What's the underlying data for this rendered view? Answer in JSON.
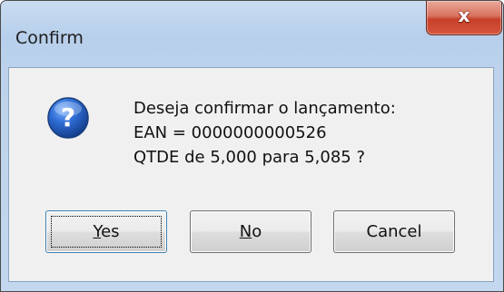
{
  "window": {
    "title": "Confirm",
    "close_glyph": "x"
  },
  "message": {
    "icon": "question-icon",
    "lines": [
      "Deseja confirmar o lançamento:",
      "EAN = 0000000000526",
      "QTDE de 5,000 para 5,085 ?"
    ]
  },
  "buttons": {
    "yes": {
      "mnemonic": "Y",
      "rest": "es"
    },
    "no": {
      "mnemonic": "N",
      "rest": "o"
    },
    "cancel": {
      "label": "Cancel"
    }
  },
  "colors": {
    "icon_blue": "#2a63c8",
    "close_red": "#c7402a"
  }
}
